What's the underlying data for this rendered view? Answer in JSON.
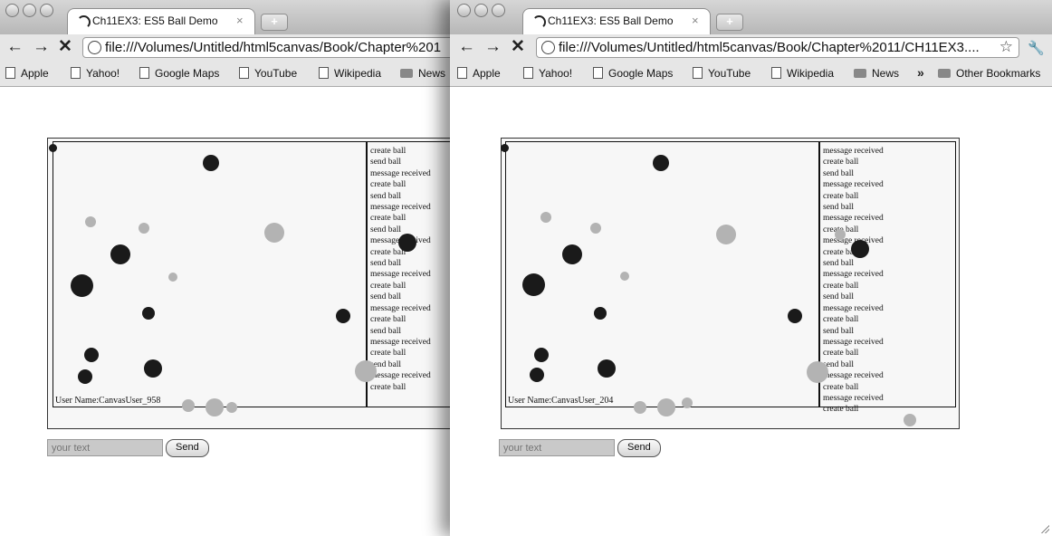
{
  "windows": [
    {
      "tab_title": "Ch11EX3: ES5 Ball Demo",
      "tab_close": "×",
      "url": "file:///Volumes/Untitled/html5canvas/Book/Chapter%201",
      "bookmarks": [
        "Apple",
        "Yahoo!",
        "Google Maps",
        "YouTube",
        "Wikipedia",
        "News"
      ],
      "log_lines": [
        "create ball",
        "send ball",
        "message received",
        "create ball",
        "send ball",
        "message received",
        "create ball",
        "send ball",
        "message received",
        "create ball",
        "send ball",
        "message received",
        "create ball",
        "send ball",
        "message received",
        "create ball",
        "send ball",
        "message received",
        "create ball",
        "send ball",
        "message received",
        "create ball"
      ],
      "user_name": "User Name:CanvasUser_958",
      "input_placeholder": "your text",
      "send_label": "Send"
    },
    {
      "tab_title": "Ch11EX3: ES5 Ball Demo",
      "tab_close": "×",
      "url": "file:///Volumes/Untitled/html5canvas/Book/Chapter%2011/CH11EX3....",
      "bookmarks": [
        "Apple",
        "Yahoo!",
        "Google Maps",
        "YouTube",
        "Wikipedia",
        "News"
      ],
      "overflow": "»",
      "other_bookmarks": "Other Bookmarks",
      "log_lines": [
        "message received",
        "create ball",
        "send ball",
        "message received",
        "create ball",
        "send ball",
        "message received",
        "create ball",
        "message received",
        "create ball",
        "send ball",
        "message received",
        "create ball",
        "send ball",
        "message received",
        "create ball",
        "send ball",
        "message received",
        "create ball",
        "send ball",
        "message received",
        "create ball",
        "message received",
        "create ball"
      ],
      "user_name": "User Name:CanvasUser_204",
      "input_placeholder": "your text",
      "send_label": "Send"
    }
  ],
  "nav_glyphs": {
    "back": "←",
    "forward": "→",
    "stop": "✕",
    "star": "☆",
    "wrench": "🔧",
    "new_tab": "+"
  },
  "colors": {
    "ball_dark": "#1a1a1a",
    "ball_light": "#b3b3b3",
    "canvas_bg": "#f7f7f7"
  }
}
